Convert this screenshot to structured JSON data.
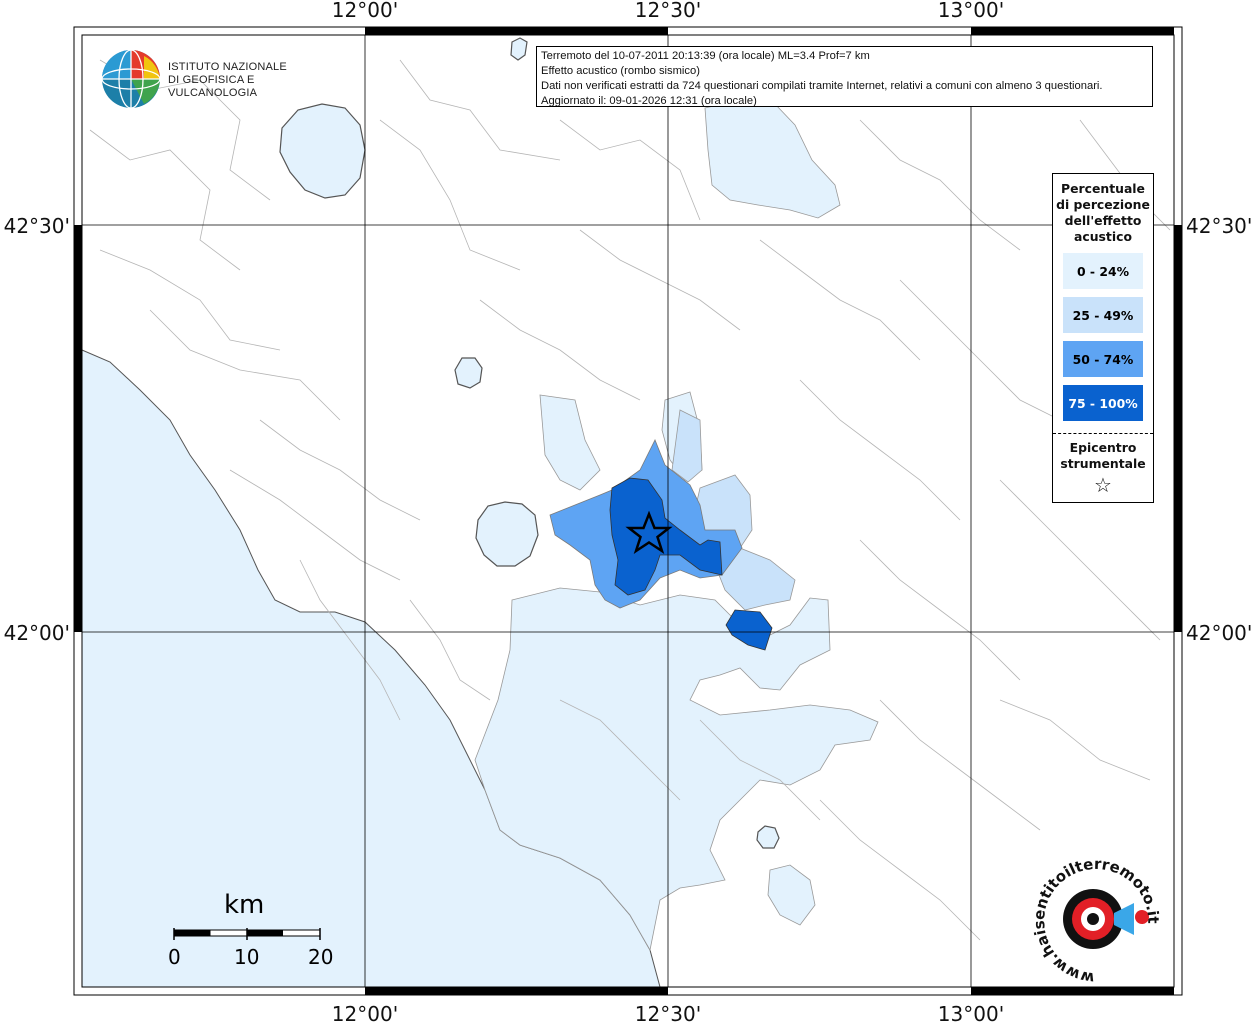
{
  "info": {
    "line1": "Terremoto del 10-07-2011 20:13:39 (ora locale) ML=3.4 Prof=7 km",
    "line2": "Effetto acustico (rombo sismico)",
    "line3": "Dati non verificati estratti da 724 questionari compilati tramite Internet, relativi a comuni con almeno 3 questionari.",
    "line4": "Aggiornato il: 09-01-2026 12:31 (ora locale)"
  },
  "axes": {
    "top": [
      "12°00'",
      "12°30'",
      "13°00'"
    ],
    "bottom": [
      "12°00'",
      "12°30'",
      "13°00'"
    ],
    "left": [
      "42°30'",
      "42°00'"
    ],
    "right": [
      "42°30'",
      "42°00'"
    ]
  },
  "legend": {
    "title": "Percentuale di percezione dell'effetto acustico",
    "classes": [
      {
        "label": "0 - 24%",
        "color": "#e3f2fd",
        "text_color": "#000000"
      },
      {
        "label": "25 - 49%",
        "color": "#c9e2fa",
        "text_color": "#000000"
      },
      {
        "label": "50 - 74%",
        "color": "#5ea4f3",
        "text_color": "#000000"
      },
      {
        "label": "75 - 100%",
        "color": "#0a62cf",
        "text_color": "#ffffff"
      }
    ],
    "epicenter_label": "Epicentro strumentale",
    "epicenter_symbol": "☆"
  },
  "logo": {
    "line1": "ISTITUTO NAZIONALE",
    "line2": "DI GEOFISICA E VULCANOLOGIA"
  },
  "scalebar": {
    "unit": "km",
    "labels": [
      "0",
      "10",
      "20"
    ]
  },
  "colors": {
    "sea": "#e3f2fd",
    "land": "#ffffff",
    "boundary": "#b5b5b5",
    "class1": "#e3f2fd",
    "class2": "#c9e2fa",
    "class3": "#5ea4f3",
    "class4": "#0a62cf"
  },
  "watermark": {
    "text": "www.haisentitoilterremoto.it"
  }
}
